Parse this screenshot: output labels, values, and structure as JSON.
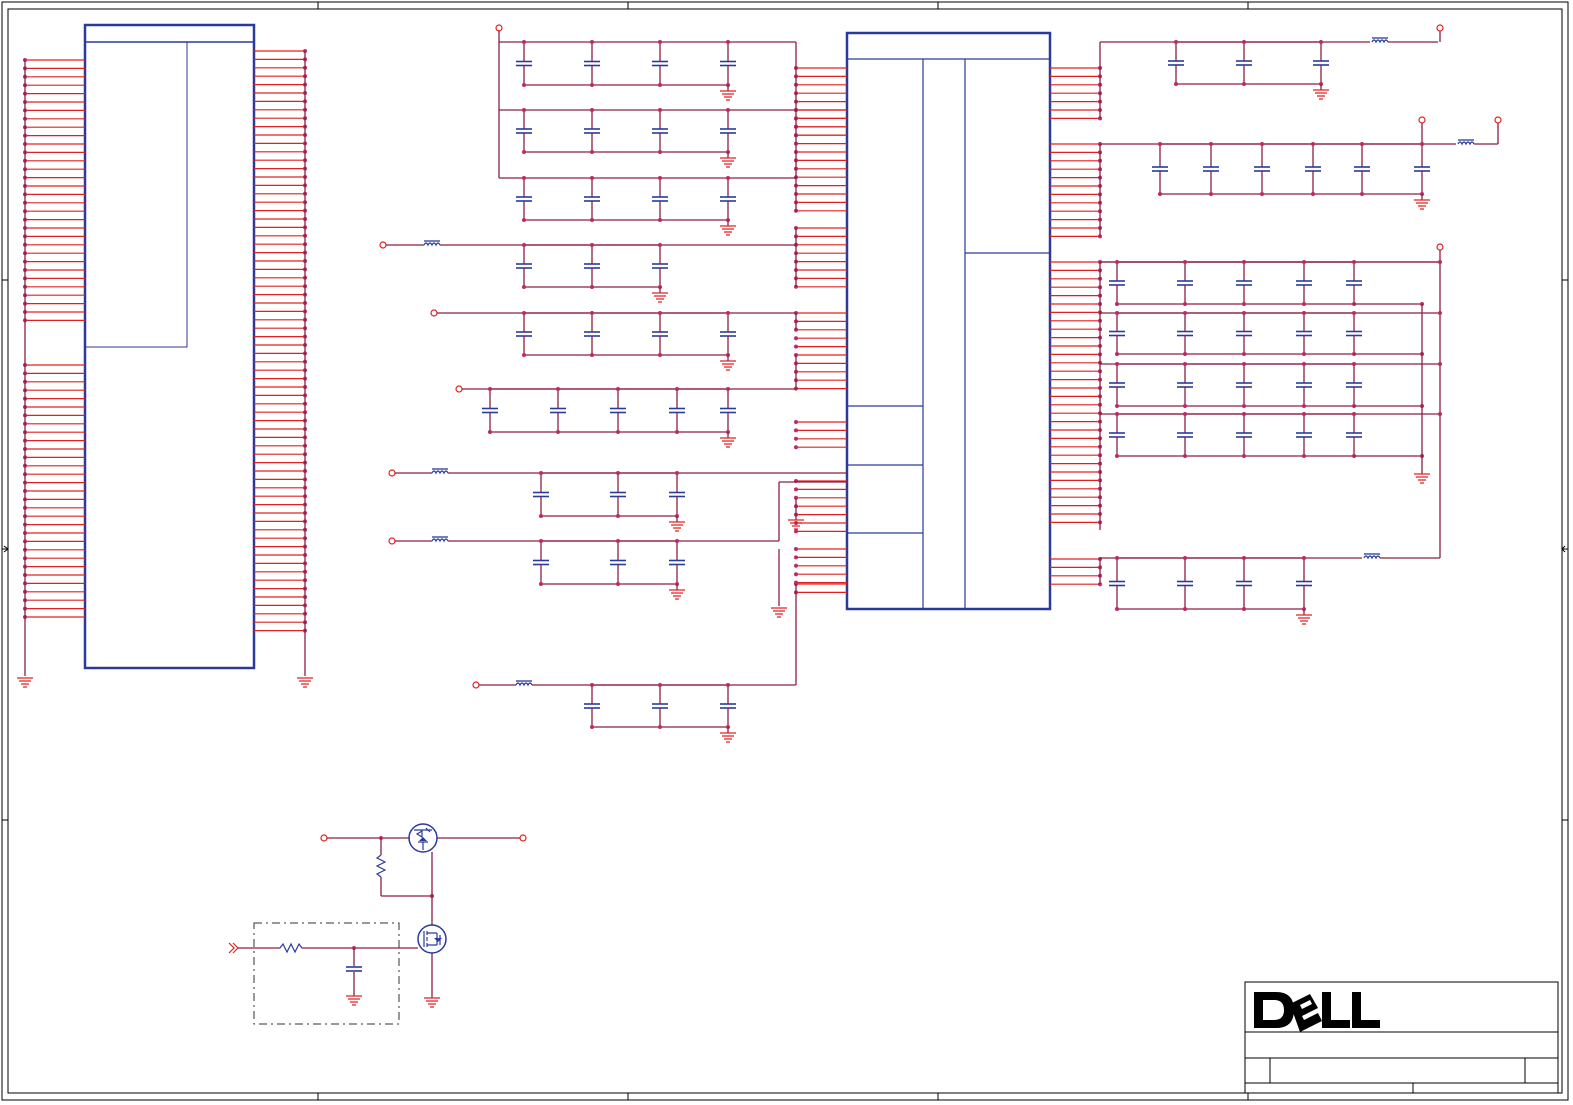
{
  "title_block": {
    "logo_text": "DELL",
    "brand_color": "#000000"
  },
  "colors": {
    "wire": "#8a2040",
    "pin": "#e02020",
    "component": "#2a3a9a",
    "junction": "#c0286a"
  }
}
